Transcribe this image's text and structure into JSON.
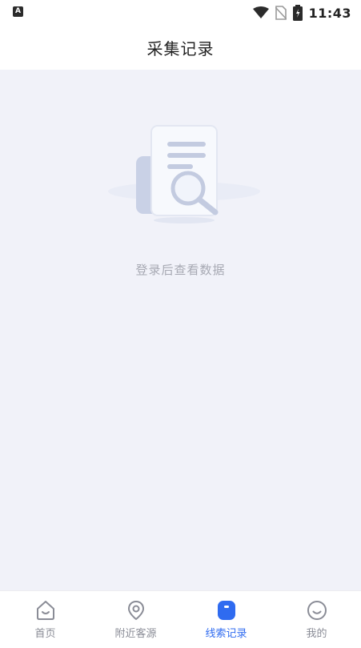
{
  "status_bar": {
    "left_badge": "A",
    "time": "11:43"
  },
  "header": {
    "title": "采集记录"
  },
  "empty_state": {
    "message": "登录后查看数据"
  },
  "tabbar": {
    "active_color": "#2f6bf0",
    "items": [
      {
        "label": "首页",
        "icon": "home-icon",
        "active": false
      },
      {
        "label": "附近客源",
        "icon": "location-pin-icon",
        "active": false
      },
      {
        "label": "线索记录",
        "icon": "clue-record-icon",
        "active": true
      },
      {
        "label": "我的",
        "icon": "profile-icon",
        "active": false
      }
    ]
  }
}
